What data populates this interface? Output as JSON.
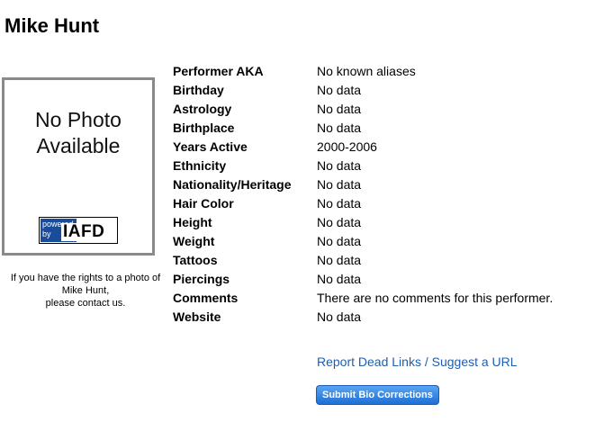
{
  "page_title": "Mike Hunt",
  "photo": {
    "placeholder_line1": "No Photo",
    "placeholder_line2": "Available",
    "badge_powered": "powered",
    "badge_by": "by",
    "badge_logo": "IAFD"
  },
  "rights_notice": {
    "line1": "If you have the rights to a photo of",
    "line2": "Mike Hunt,",
    "line3": "please contact us."
  },
  "bio_rows": [
    {
      "label": "Performer AKA",
      "value": "No known aliases"
    },
    {
      "label": "Birthday",
      "value": "No data"
    },
    {
      "label": "Astrology",
      "value": "No data"
    },
    {
      "label": "Birthplace",
      "value": "No data"
    },
    {
      "label": "Years Active",
      "value": "2000-2006"
    },
    {
      "label": "Ethnicity",
      "value": "No data"
    },
    {
      "label": "Nationality/Heritage",
      "value": "No data"
    },
    {
      "label": "Hair Color",
      "value": "No data"
    },
    {
      "label": "Height",
      "value": "No data"
    },
    {
      "label": "Weight",
      "value": "No data"
    },
    {
      "label": "Tattoos",
      "value": "No data"
    },
    {
      "label": "Piercings",
      "value": "No data"
    },
    {
      "label": "Comments",
      "value": "There are no comments for this performer."
    },
    {
      "label": "Website",
      "value": "No data"
    }
  ],
  "links": {
    "report_dead_links": "Report Dead Links / Suggest a URL",
    "submit_bio": "Submit Bio Corrections"
  },
  "colors": {
    "link": "#1f5fad",
    "button": "#1d6fd6",
    "photo_border": "#8a8a8a",
    "badge_blue": "#1a4c9c"
  }
}
